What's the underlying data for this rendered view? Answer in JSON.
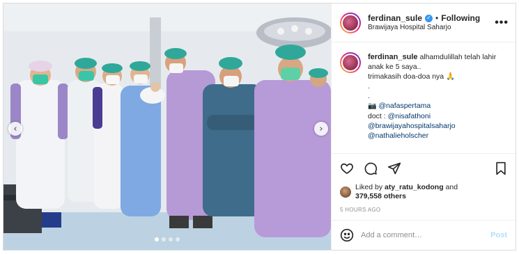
{
  "post": {
    "username": "ferdinan_sule",
    "following_label": "Following",
    "location": "Brawijaya Hospital Saharjo",
    "more_label": "•••",
    "caption": {
      "line1": "alhamdulillah telah lahir anak ke 5 saya..",
      "line2": "trimakasih doa-doa nya 🙏",
      "dot1": ".",
      "dot2": ".",
      "camera": "📷",
      "mention1": "@nafaspertama",
      "doctor_label": "doct : ",
      "mention2": "@nisafathoni",
      "mention3": "@brawijayahospitalsaharjo",
      "mention4": "@nathalieholscher"
    },
    "likes": {
      "prefix": "Liked by ",
      "user": "aty_ratu_kodong",
      "and": " and",
      "count": "379,558 others"
    },
    "timestamp": "5 HOURS AGO",
    "comment": {
      "placeholder": "Add a comment…",
      "post_label": "Post"
    },
    "carousel": {
      "prev": "‹",
      "next": "›",
      "slides": 4,
      "active": 0
    }
  },
  "icons": {
    "verified": "✓",
    "heart": "heart-icon",
    "comment": "comment-icon",
    "share": "share-icon",
    "save": "bookmark-icon",
    "emoji": "emoji-icon"
  }
}
